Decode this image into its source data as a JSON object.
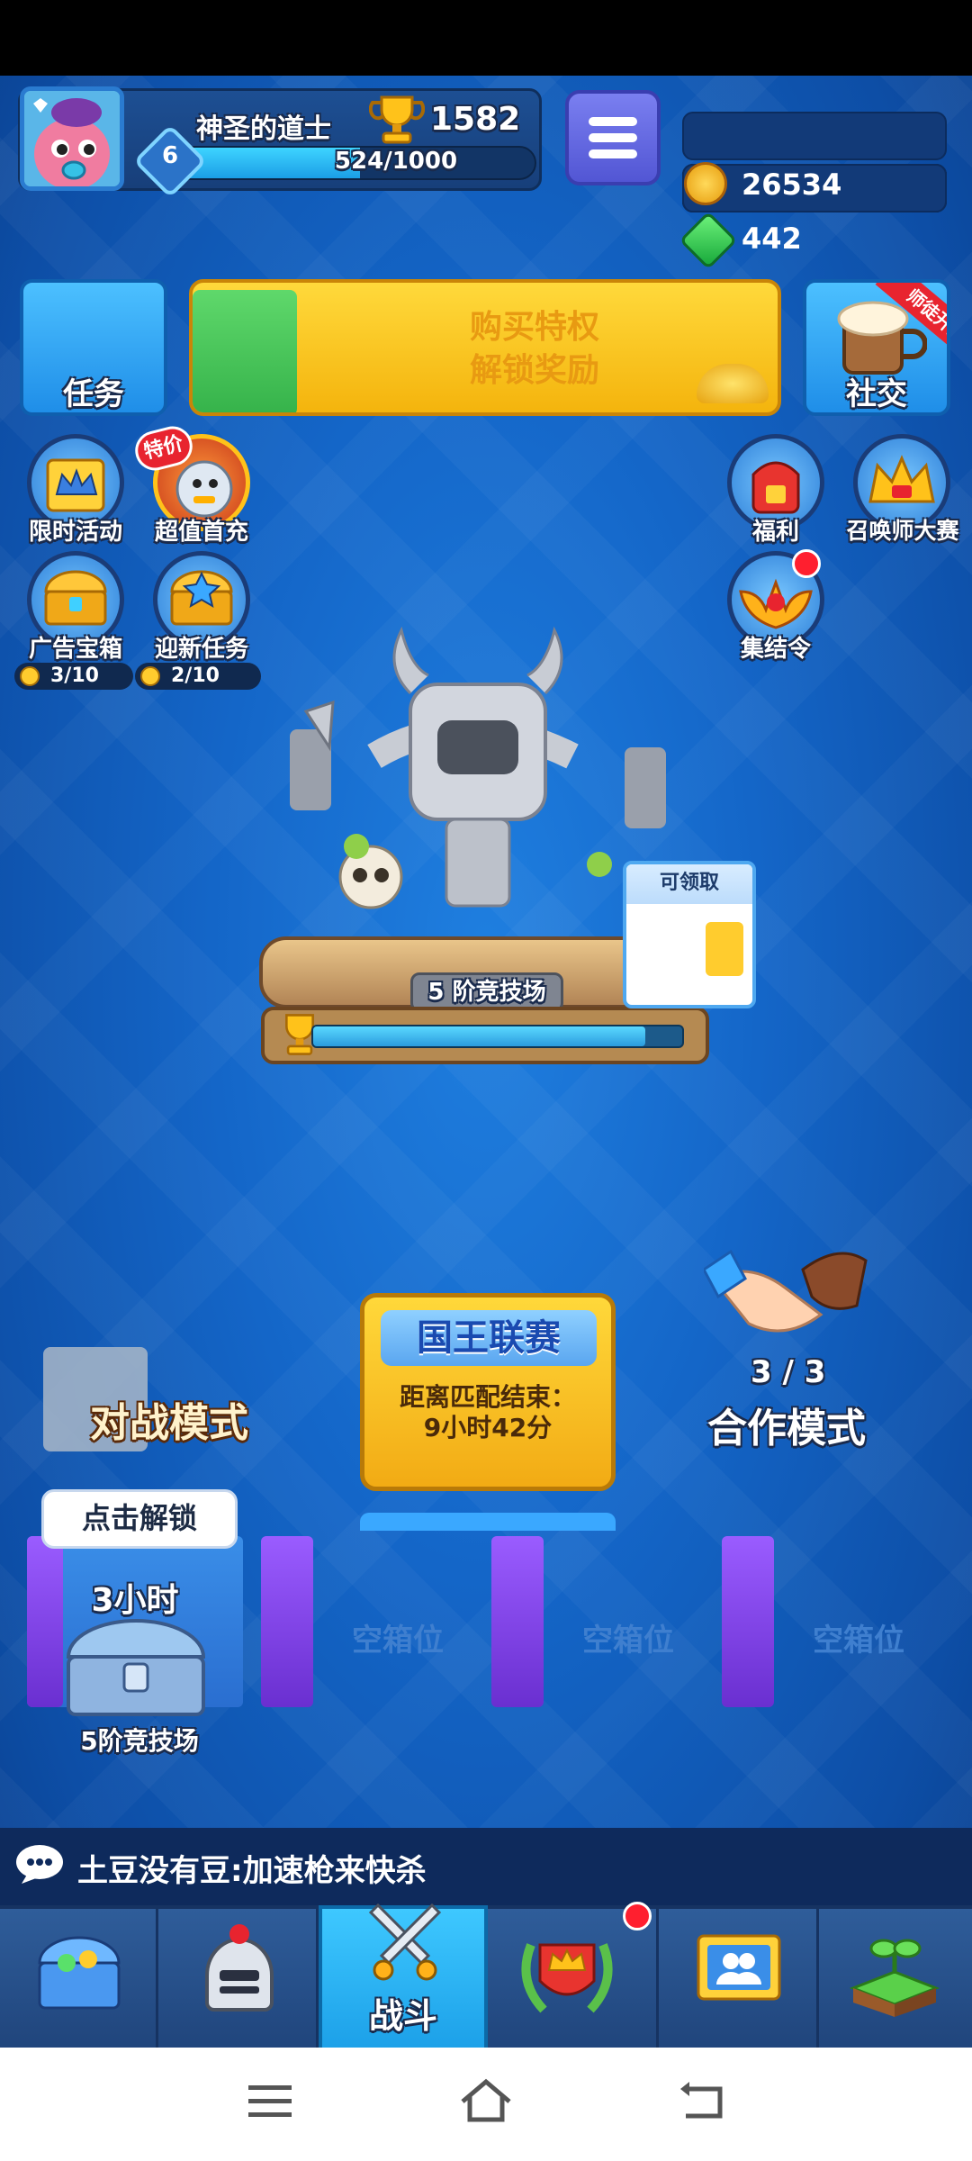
{
  "profile": {
    "name": "神圣的道士",
    "trophies": "1582",
    "level": "6",
    "xp_text": "524/1000",
    "xp_progress": 0.524
  },
  "resources": {
    "gold": "26534",
    "gems": "442"
  },
  "buttons": {
    "tasks": "任务",
    "social": "社交",
    "social_ribbon": "师徒开启",
    "banner_line1": "购买特权",
    "banner_line2": "解锁奖励"
  },
  "left_icons": [
    {
      "label": "限时活动"
    },
    {
      "label": "超值首充",
      "tag": "特价"
    },
    {
      "label": "广告宝箱",
      "counter": "3/10"
    },
    {
      "label": "迎新任务",
      "counter": "2/10"
    }
  ],
  "right_icons": [
    {
      "label": "福利"
    },
    {
      "label": "召唤师大赛"
    },
    {
      "label": "集结令"
    }
  ],
  "arena": {
    "name": "5 阶竞技场",
    "reward_label": "可领取",
    "progress": 0.9
  },
  "modes": {
    "battle": "对战模式",
    "league_title": "国王联赛",
    "league_sub1": "距离匹配结束：",
    "league_sub2": "9小时42分",
    "coop_count": "3 / 3",
    "coop": "合作模式"
  },
  "chests": {
    "unlock_label": "点击解锁",
    "timer": "3小时",
    "arena": "5阶竞技场",
    "empty_label": "空箱位"
  },
  "chat": {
    "message": "土豆没有豆:加速枪来快杀"
  },
  "nav": {
    "battle_label": "战斗"
  },
  "colors": {
    "bg_blue": "#1466c8",
    "accent_yellow": "#f4b40d",
    "notification_red": "#ff1f2f"
  }
}
